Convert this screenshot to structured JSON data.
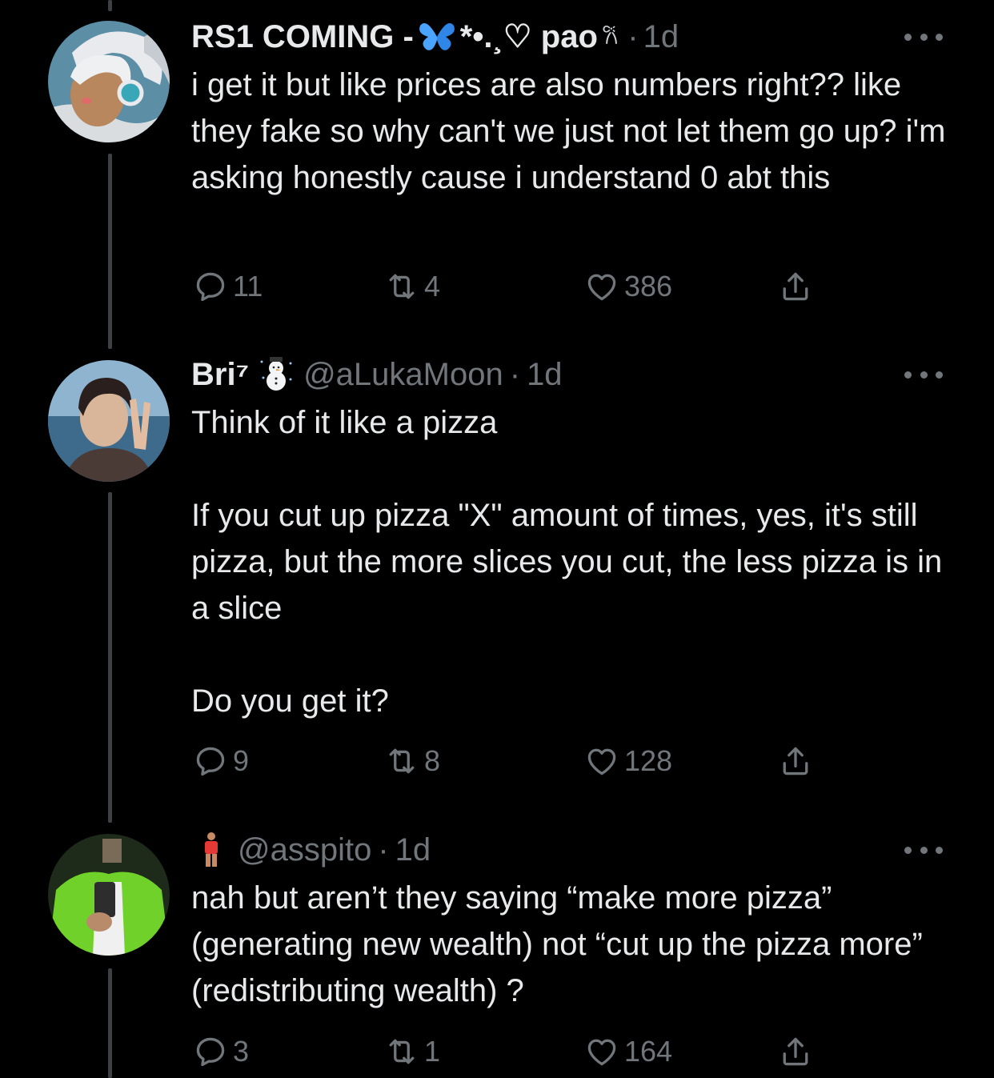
{
  "tweets": [
    {
      "name_prefix": "RS1 COMING -",
      "name_suffix": "*•.¸♡ pao",
      "emoji_after_name": "𐙚",
      "handle": "",
      "time": "1d",
      "text": "i get it but like prices are also numbers right?? like they fake so why can't we just not let them go up? i'm asking honestly cause i understand 0 abt this",
      "replies": "11",
      "retweets": "4",
      "likes": "386"
    },
    {
      "name_prefix": "Bri⁷",
      "handle": "@aLukaMoon",
      "time": "1d",
      "text": "Think of it like a pizza\n\nIf you cut up pizza \"X\" amount of times, yes, it's still pizza, but the more slices you cut, the less pizza is in a slice\n\nDo you get it?",
      "replies": "9",
      "retweets": "8",
      "likes": "128"
    },
    {
      "handle": "@asspito",
      "time": "1d",
      "text": "nah but aren’t they saying “make more pizza” (generating new wealth) not “cut up the pizza more” (redistributing wealth) ?",
      "replies": "3",
      "retweets": "1",
      "likes": "164"
    }
  ],
  "separator": "·",
  "icons": {
    "reply": "reply-icon",
    "retweet": "retweet-icon",
    "like": "heart-icon",
    "share": "share-icon",
    "more": "more-icon"
  },
  "colors": {
    "background": "#000000",
    "text": "#e7e9ea",
    "muted": "#71767b",
    "thread_line": "#3e4144",
    "butterfly": "#4aa3ff"
  }
}
